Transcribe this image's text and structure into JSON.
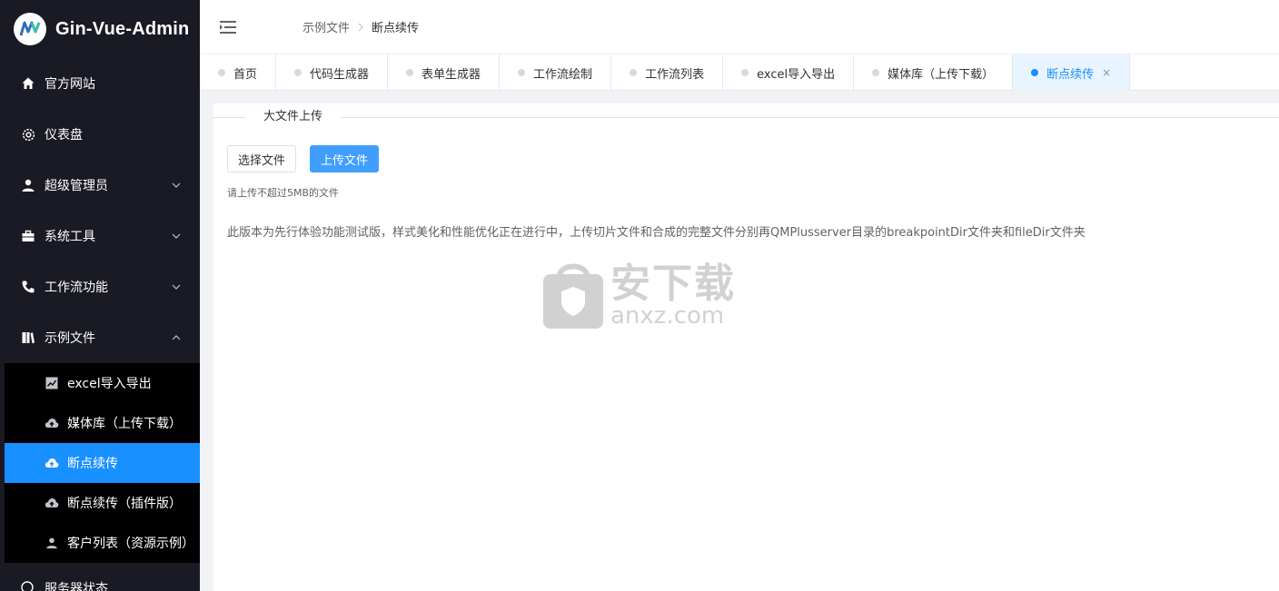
{
  "app": {
    "title": "Gin-Vue-Admin"
  },
  "sidebar": {
    "items": [
      {
        "label": "官方网站",
        "icon": "home-icon"
      },
      {
        "label": "仪表盘",
        "icon": "gear-icon"
      },
      {
        "label": "超级管理员",
        "icon": "user-icon",
        "expandable": true
      },
      {
        "label": "系统工具",
        "icon": "toolbox-icon",
        "expandable": true
      },
      {
        "label": "工作流功能",
        "icon": "phone-icon",
        "expandable": true
      },
      {
        "label": "示例文件",
        "icon": "files-icon",
        "expanded": true
      }
    ],
    "subitems": [
      {
        "label": "excel导入导出",
        "icon": "chart-icon"
      },
      {
        "label": "媒体库（上传下载）",
        "icon": "cloud-upload-icon"
      },
      {
        "label": "断点续传",
        "icon": "cloud-upload-icon",
        "active": true
      },
      {
        "label": "断点续传（插件版）",
        "icon": "cloud-upload-icon"
      },
      {
        "label": "客户列表（资源示例）",
        "icon": "user-icon"
      }
    ],
    "cut_item": {
      "label": "服务器状态"
    }
  },
  "breadcrumb": {
    "parent": "示例文件",
    "current": "断点续传"
  },
  "tabs": [
    {
      "label": "首页"
    },
    {
      "label": "代码生成器"
    },
    {
      "label": "表单生成器"
    },
    {
      "label": "工作流绘制"
    },
    {
      "label": "工作流列表"
    },
    {
      "label": "excel导入导出"
    },
    {
      "label": "媒体库（上传下载）"
    },
    {
      "label": "断点续传",
      "active": true,
      "close": "×"
    }
  ],
  "content": {
    "section_title": "大文件上传",
    "choose_button": "选择文件",
    "upload_button": "上传文件",
    "tip": "请上传不超过5MB的文件",
    "description": "此版本为先行体验功能测试版，样式美化和性能优化正在进行中，上传切片文件和合成的完整文件分别再QMPlusserver目录的breakpointDir文件夹和fileDir文件夹"
  },
  "watermark": {
    "cn": "安下载",
    "en": "anxz.com"
  },
  "colors": {
    "sidebar_bg": "#191a23",
    "active": "#1890ff",
    "primary_button": "#409eff"
  }
}
